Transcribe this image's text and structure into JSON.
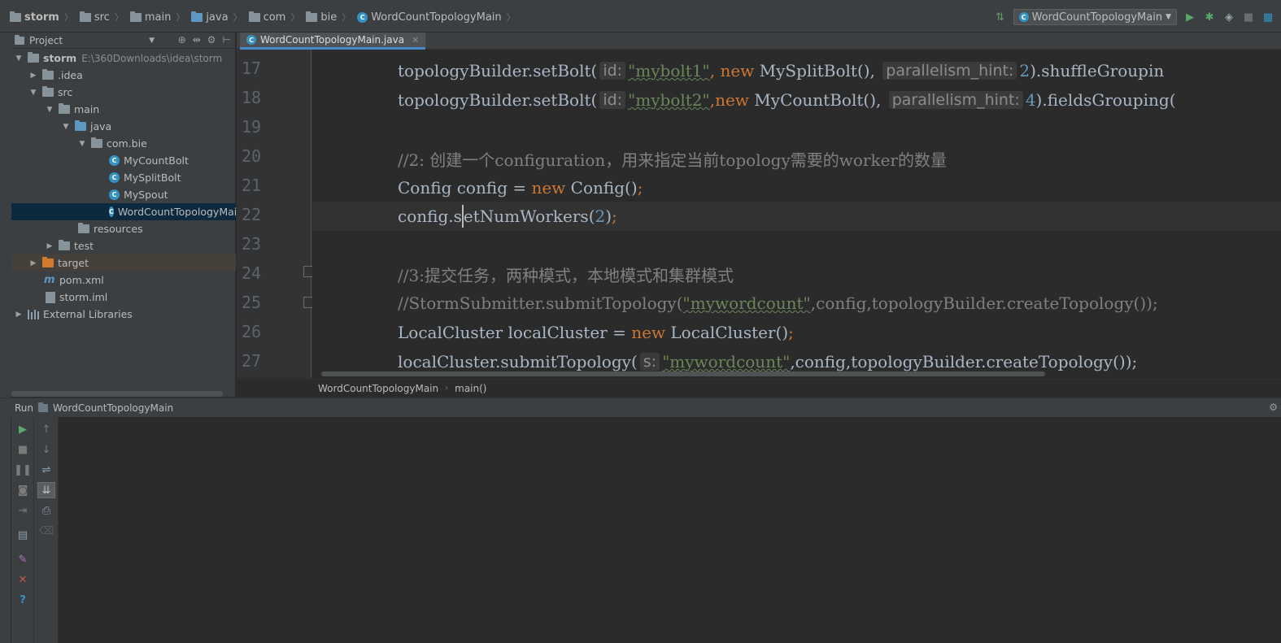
{
  "navbar": {
    "crumbs": [
      "storm",
      "src",
      "main",
      "java",
      "com",
      "bie",
      "WordCountTopologyMain"
    ],
    "run_config": "WordCountTopologyMain"
  },
  "project": {
    "title": "Project",
    "tree": [
      {
        "label": "storm",
        "path": "E:\\360Downloads\\idea\\storm"
      },
      {
        "label": ".idea"
      },
      {
        "label": "src"
      },
      {
        "label": "main"
      },
      {
        "label": "java"
      },
      {
        "label": "com.bie"
      },
      {
        "label": "MyCountBolt"
      },
      {
        "label": "MySplitBolt"
      },
      {
        "label": "MySpout"
      },
      {
        "label": "WordCountTopologyMain"
      },
      {
        "label": "resources"
      },
      {
        "label": "test"
      },
      {
        "label": "target"
      },
      {
        "label": "pom.xml"
      },
      {
        "label": "storm.iml"
      },
      {
        "label": "External Libraries"
      }
    ]
  },
  "editor": {
    "tab": "WordCountTopologyMain.java",
    "line_numbers": [
      "17",
      "18",
      "19",
      "20",
      "21",
      "22",
      "23",
      "24",
      "25",
      "26",
      "27"
    ],
    "code": {
      "l17": {
        "a": "topologyBuilder.setBolt(",
        "hint1": "id:",
        "s": "\"mybolt1\"",
        "b": ", ",
        "kw": "new",
        "c": " MySplitBolt(), ",
        "hint2": "parallelism_hint:",
        "n": "2",
        "d": ").shuffleGroupin"
      },
      "l18": {
        "a": "topologyBuilder.setBolt(",
        "hint1": "id:",
        "s": "\"mybolt2\"",
        "b": ",",
        "kw": "new",
        "c": " MyCountBolt(), ",
        "hint2": "parallelism_hint:",
        "n": "4",
        "d": ").fieldsGrouping("
      },
      "l20": "//2: 创建一个configuration，用来指定当前topology需要的worker的数量",
      "l21": {
        "a": "Config config = ",
        "kw": "new",
        "b": " Config()",
        "semi": ";"
      },
      "l22": {
        "a": "config.s",
        "b": "etNumWorkers(",
        "n": "2",
        "c": ")",
        "semi": ";"
      },
      "l24": "//3:提交任务，两种模式，本地模式和集群模式",
      "l25": {
        "a": "//StormSubmitter.submitTopology(",
        "s": "\"mywordcount\"",
        "b": ",config,topologyBuilder.createTopology());"
      },
      "l26": {
        "a": "LocalCluster localCluster = ",
        "kw": "new",
        "b": " LocalCluster()",
        "semi": ";"
      },
      "l27": {
        "a": "localCluster.submitTopology(",
        "hint": "s:",
        "s": "\"mywordcount\"",
        "b": ",config,topologyBuilder.createTopology());"
      }
    },
    "breadcrumb": [
      "WordCountTopologyMain",
      "main()"
    ]
  },
  "run": {
    "label": "Run",
    "config": "WordCountTopologyMain"
  },
  "colors": {
    "keyword": "#cc7832",
    "string": "#6a8759",
    "number": "#6897bb",
    "comment": "#808080",
    "selection": "#0d293e"
  }
}
